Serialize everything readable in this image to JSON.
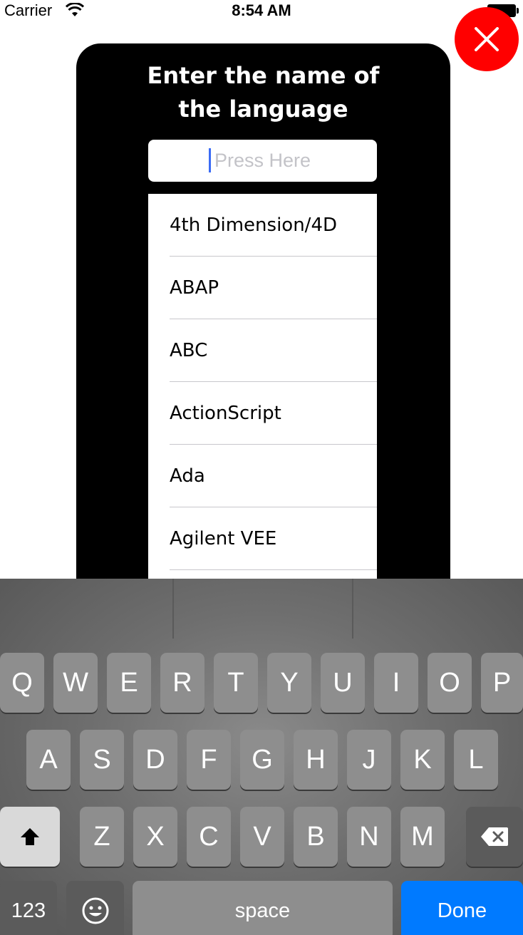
{
  "status_bar": {
    "carrier": "Carrier",
    "time": "8:54 AM"
  },
  "dialog": {
    "title_line1": "Enter the name of",
    "title_line2": "the language",
    "search_placeholder": "Press Here"
  },
  "languages": [
    "4th Dimension/4D",
    "ABAP",
    "ABC",
    "ActionScript",
    "Ada",
    "Agilent VEE"
  ],
  "keyboard": {
    "row1": [
      "Q",
      "W",
      "E",
      "R",
      "T",
      "Y",
      "U",
      "I",
      "O",
      "P"
    ],
    "row2": [
      "A",
      "S",
      "D",
      "F",
      "G",
      "H",
      "J",
      "K",
      "L"
    ],
    "row3": [
      "Z",
      "X",
      "C",
      "V",
      "B",
      "N",
      "M"
    ],
    "numbers_label": "123",
    "space_label": "space",
    "done_label": "Done"
  },
  "colors": {
    "close_button": "#ff0000",
    "done_key": "#007aff"
  }
}
